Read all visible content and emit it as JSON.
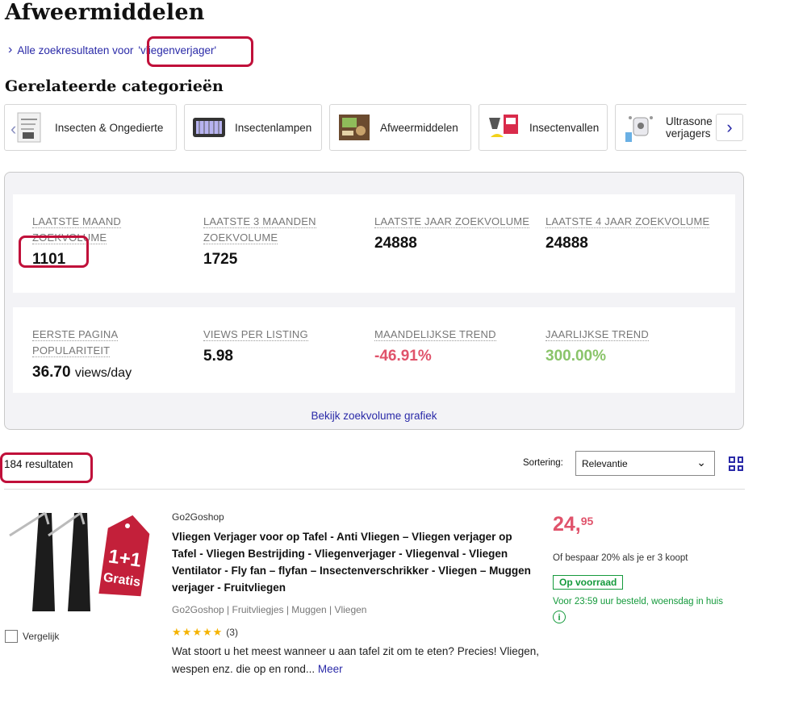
{
  "page_title": "Afweermiddelen",
  "back_link": {
    "prefix": "Alle zoekresultaten voor",
    "query": "'vliegenverjager'"
  },
  "related_heading": "Gerelateerde categorieën",
  "categories": [
    {
      "label": "Insecten & Ongedierte"
    },
    {
      "label": "Insectenlampen"
    },
    {
      "label": "Afweermiddelen"
    },
    {
      "label": "Insectenvallen"
    },
    {
      "label": "Ultrasone verjagers"
    }
  ],
  "stats": {
    "row1": [
      {
        "label": "LAATSTE MAAND ZOEKVOLUME",
        "value": "1101"
      },
      {
        "label": "LAATSTE 3 MAANDEN ZOEKVOLUME",
        "value": "1725"
      },
      {
        "label": "LAATSTE JAAR ZOEKVOLUME",
        "value": "24888"
      },
      {
        "label": "LAATSTE 4 JAAR ZOEKVOLUME",
        "value": "24888"
      }
    ],
    "row2": [
      {
        "label": "EERSTE PAGINA POPULARITEIT",
        "value": "36.70",
        "unit": "views/day"
      },
      {
        "label": "VIEWS PER LISTING",
        "value": "5.98"
      },
      {
        "label": "MAANDELIJKSE TREND",
        "value": "-46.91%"
      },
      {
        "label": "JAARLIJKSE TREND",
        "value": "300.00%"
      }
    ],
    "graph_link": "Bekijk zoekvolume grafiek"
  },
  "results": {
    "count": "184 resultaten",
    "sort_label": "Sortering:",
    "sort_value": "Relevantie"
  },
  "product": {
    "seller": "Go2Goshop",
    "title": "Vliegen Verjager voor op Tafel - Anti Vliegen – Vliegen verjager op Tafel - Vliegen Bestrijding - Vliegenverjager - Vliegenval - Vliegen Ventilator - Fly fan – flyfan – Insectenverschrikker - Vliegen – Muggen verjager - Fruitvliegen",
    "categories": "Go2Goshop | Fruitvliegjes | Muggen | Vliegen",
    "rating_count": "(3)",
    "description": "Wat stoort u het meest wanneer u aan tafel zit om te eten? Precies! Vliegen, wespen enz. die op en rond...",
    "more": "Meer",
    "price_main": "24,",
    "price_cents": "95",
    "discount": "Of bespaar 20% als je er 3 koopt",
    "stock": "Op voorraad",
    "delivery": "Voor 23:59 uur besteld, woensdag in huis",
    "tag_line1": "1+1",
    "tag_line2": "Gratis",
    "compare": "Vergelijk"
  },
  "colors": {
    "link": "#2a2aa8",
    "highlight": "#c0103a",
    "negative": "#e0536b",
    "positive": "#8ac46a",
    "stock": "#159a3c"
  }
}
